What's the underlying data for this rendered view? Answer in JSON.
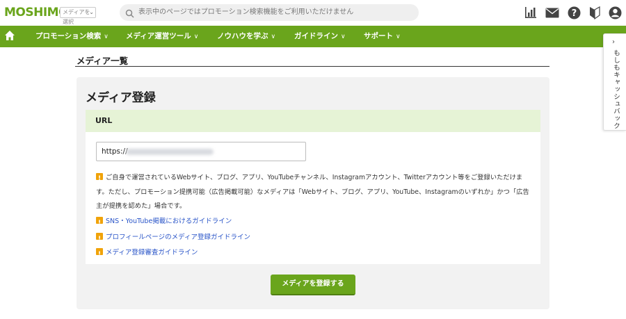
{
  "header": {
    "logo": "MOSHIMO",
    "media_select": "メディアを選択",
    "search_placeholder": "表示中のページではプロモーション検索機能をご利用いただけません",
    "icons": [
      "bar-chart-icon",
      "mail-icon",
      "help-icon",
      "beginner-mark-icon",
      "user-icon"
    ]
  },
  "nav": {
    "items": [
      {
        "label": "プロモーション検索"
      },
      {
        "label": "メディア運営ツール"
      },
      {
        "label": "ノウハウを学ぶ"
      },
      {
        "label": "ガイドライン"
      },
      {
        "label": "サポート"
      }
    ],
    "caret": "∨"
  },
  "side_tab": {
    "label": "もしもキャッシュバック"
  },
  "page": {
    "title": "メディア一覧"
  },
  "card": {
    "title": "メディア登録",
    "url_section": "URL",
    "url_value": "https://",
    "notice": "ご自身で運営されているWebサイト、ブログ、アプリ、YouTubeチャンネル、Instagramアカウント、Twitterアカウント等をご登録いただけます。ただし、プロモーション提携可能（広告掲載可能）なメディアは「Webサイト、ブログ、アプリ、YouTube、Instagramのいずれか」かつ「広告主が提携を認めた」場合です。",
    "links": [
      "SNS・YouTube掲載におけるガイドライン",
      "プロフィールページのメディア登録ガイドライン",
      "メディア登録審査ガイドライン"
    ],
    "submit_label": "メディアを登録する"
  },
  "colors": {
    "brand_green": "#6aa51c",
    "section_bg": "#e6f3d6",
    "link": "#2a55c8",
    "warning": "#f0a30a"
  }
}
